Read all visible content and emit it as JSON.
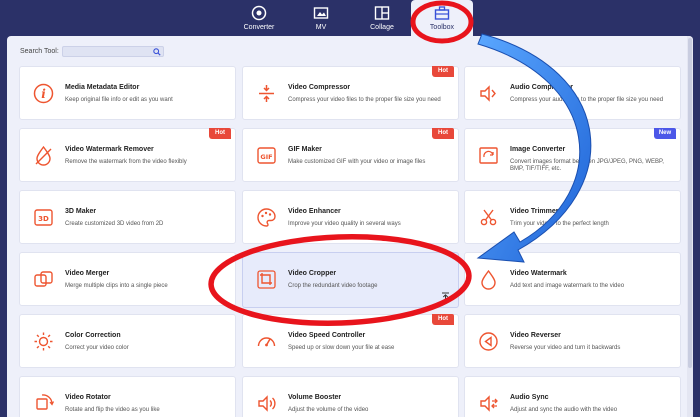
{
  "nav": {
    "items": [
      {
        "label": "Converter",
        "icon": "converter-icon"
      },
      {
        "label": "MV",
        "icon": "mv-icon"
      },
      {
        "label": "Collage",
        "icon": "collage-icon"
      },
      {
        "label": "Toolbox",
        "icon": "toolbox-icon"
      }
    ],
    "active": "Toolbox"
  },
  "search": {
    "label": "Search Tool:",
    "value": "",
    "placeholder": ""
  },
  "colors": {
    "accent": "#ee5530",
    "hot": "#e8483a",
    "new": "#4c57e8",
    "nav_bg": "#2b3168",
    "panel_bg": "#eef0fa",
    "annotation": "#e8141c",
    "arrow": "#2b7bea"
  },
  "tools": [
    {
      "title": "Media Metadata Editor",
      "desc": "Keep original file info or edit as you want",
      "icon": "info-icon",
      "badge": ""
    },
    {
      "title": "Video Compressor",
      "desc": "Compress your video files to the proper file size you need",
      "icon": "compress-icon",
      "badge": "Hot"
    },
    {
      "title": "Audio Compressor",
      "desc": "Compress your audio files to the proper file size you need",
      "icon": "audio-compress-icon",
      "badge": ""
    },
    {
      "title": "Video Watermark Remover",
      "desc": "Remove the watermark from the video flexibly",
      "icon": "watermark-remover-icon",
      "badge": "Hot"
    },
    {
      "title": "GIF Maker",
      "desc": "Make customized GIF with your video or image files",
      "icon": "gif-icon",
      "badge": "Hot"
    },
    {
      "title": "Image Converter",
      "desc": "Convert images format between JPG/JPEG, PNG, WEBP,",
      "desc2": "BMP, TIF/TIFF, etc.",
      "icon": "image-convert-icon",
      "badge": "New"
    },
    {
      "title": "3D Maker",
      "desc": "Create customized 3D video from 2D",
      "icon": "3d-icon",
      "badge": ""
    },
    {
      "title": "Video Enhancer",
      "desc": "Improve your video quality in several ways",
      "icon": "palette-icon",
      "badge": ""
    },
    {
      "title": "Video Trimmer",
      "desc": "Trim your videos to the perfect length",
      "icon": "scissors-icon",
      "badge": ""
    },
    {
      "title": "Video Merger",
      "desc": "Merge multiple clips into a single piece",
      "icon": "merge-icon",
      "badge": ""
    },
    {
      "title": "Video Cropper",
      "desc": "Crop the redundant video footage",
      "icon": "crop-icon",
      "badge": "",
      "selected": true
    },
    {
      "title": "Video Watermark",
      "desc": "Add text and image watermark to the video",
      "icon": "watermark-icon",
      "badge": ""
    },
    {
      "title": "Color Correction",
      "desc": "Correct your video color",
      "icon": "sun-icon",
      "badge": ""
    },
    {
      "title": "Video Speed Controller",
      "desc": "Speed up or slow down your file at ease",
      "icon": "speed-icon",
      "badge": "Hot"
    },
    {
      "title": "Video Reverser",
      "desc": "Reverse your video and turn it backwards",
      "icon": "reverse-icon",
      "badge": ""
    },
    {
      "title": "Video Rotator",
      "desc": "Rotate and flip the video as you like",
      "icon": "rotate-icon",
      "badge": ""
    },
    {
      "title": "Volume Booster",
      "desc": "Adjust the volume of the video",
      "icon": "volume-icon",
      "badge": ""
    },
    {
      "title": "Audio Sync",
      "desc": "Adjust and sync the audio with the video",
      "icon": "audio-sync-icon",
      "badge": ""
    }
  ]
}
